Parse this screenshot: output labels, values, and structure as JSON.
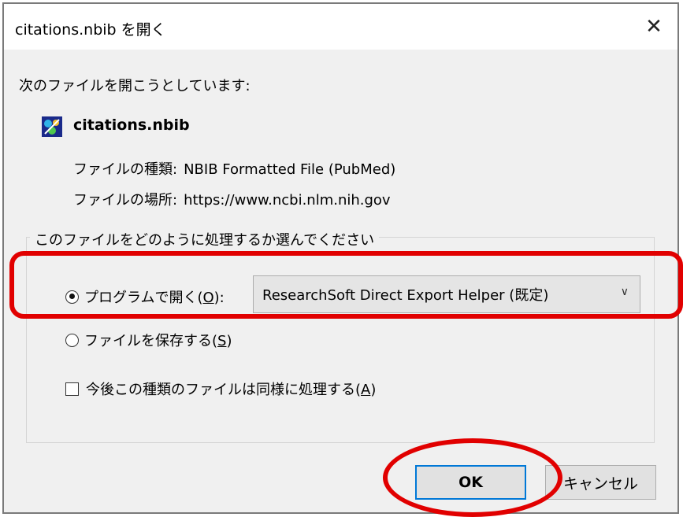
{
  "dialog": {
    "title": "citations.nbib を開く",
    "close_glyph": "✕",
    "intro": "次のファイルを開こうとしています:",
    "file": {
      "icon": "application-file-icon",
      "name": "citations.nbib",
      "type_label": "ファイルの種類:",
      "type_value": "NBIB Formatted File (PubMed)",
      "location_label": "ファイルの場所:",
      "location_value": "https://www.ncbi.nlm.nih.gov"
    },
    "group": {
      "legend": "このファイルをどのように処理するか選んでください",
      "open_with": {
        "label_prefix": "プログラムで開く(",
        "accel": "O",
        "label_suffix": "):",
        "checked": true,
        "selected_app": "ResearchSoft Direct Export Helper (既定)"
      },
      "save_file": {
        "label_prefix": "ファイルを保存する(",
        "accel": "S",
        "label_suffix": ")",
        "checked": false
      },
      "remember": {
        "label_prefix": "今後この種類のファイルは同様に処理する(",
        "accel": "A",
        "label_suffix": ")",
        "checked": false
      }
    },
    "buttons": {
      "ok": "OK",
      "cancel": "キャンセル"
    }
  },
  "annotations": {
    "color": "#e10000"
  }
}
